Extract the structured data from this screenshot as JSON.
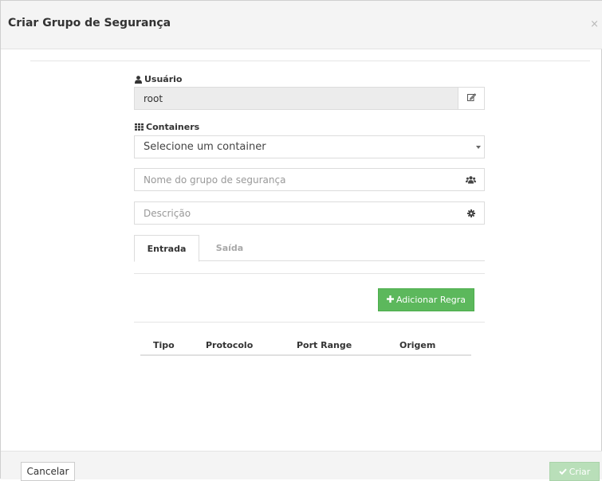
{
  "modal": {
    "title": "Criar Grupo de Segurança",
    "close_glyph": "×"
  },
  "usuario": {
    "label": "Usuário",
    "label_icon": "user-icon",
    "value": "root",
    "edit_icon": "edit-icon"
  },
  "containers": {
    "label": "Containers",
    "label_icon": "th-grid-icon",
    "selected": "Selecione um container"
  },
  "nome": {
    "placeholder": "Nome do grupo de segurança",
    "icon": "users-icon"
  },
  "descricao": {
    "placeholder": "Descrição",
    "icon": "gear-icon"
  },
  "tabs": [
    {
      "label": "Entrada",
      "active": true
    },
    {
      "label": "Saída",
      "active": false
    }
  ],
  "add_rule": {
    "label": "Adicionar Regra",
    "icon": "plus-icon"
  },
  "rules_table": {
    "headers": [
      "Tipo",
      "Protocolo",
      "Port Range",
      "Origem"
    ]
  },
  "footer": {
    "cancel_label": "Cancelar",
    "create_label": "Criar",
    "create_icon": "check-icon"
  },
  "colors": {
    "success": "#5cb85c",
    "success_disabled": "#b9dfb9",
    "header_bg": "#f4f4f4"
  }
}
